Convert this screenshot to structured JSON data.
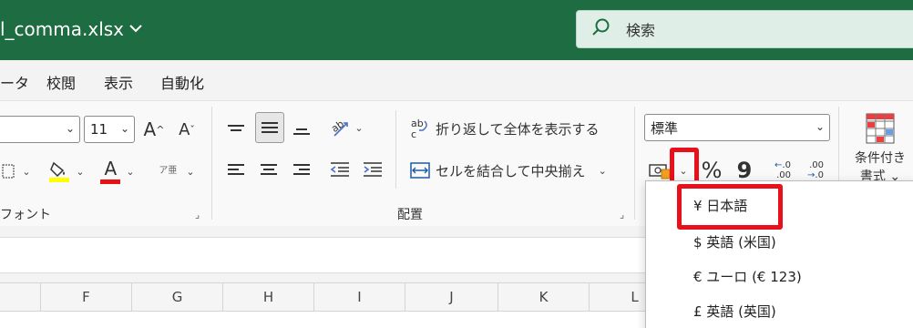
{
  "titlebar": {
    "filename": "l_comma.xlsx",
    "search_placeholder": "検索"
  },
  "menu": [
    "ータ",
    "校閲",
    "表示",
    "自動化"
  ],
  "ribbon": {
    "font_size": "11",
    "grow_font": "A",
    "shrink_font": "A",
    "font_color_letter": "A",
    "phonetic": "ア亜",
    "font_group_label": "フォント",
    "wrap_text": "折り返して全体を表示する",
    "merge_center": "セルを結合して中央揃え",
    "alignment_group_label": "配置",
    "number_format": "標準",
    "percent": "%",
    "comma": "9",
    "increase_decimal": ".00",
    "decrease_decimal": ".0",
    "conditional_format": "条件付き",
    "conditional_format_2": "書式"
  },
  "currency_menu": {
    "items": [
      "¥ 日本語",
      "$ 英語 (米国)",
      "€ ユーロ (€ 123)",
      "£ 英語 (英国)"
    ]
  },
  "columns": [
    "F",
    "G",
    "H",
    "I",
    "J",
    "K",
    "L"
  ],
  "colors": {
    "excel_green": "#1e6c41",
    "highlight_red": "#e8101a",
    "highlighter_yellow": "#ffff00",
    "font_red": "#e81010"
  }
}
